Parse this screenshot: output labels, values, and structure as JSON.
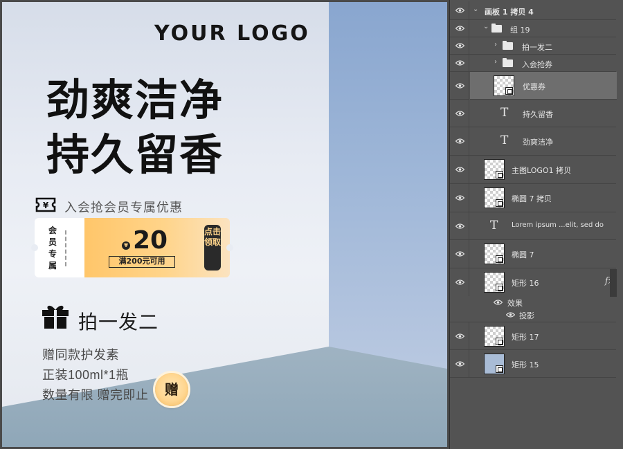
{
  "canvas": {
    "logo": "YOUR LOGO",
    "headline_line1": "劲爽洁净",
    "headline_line2": "持久留香",
    "member_text": "入会抢会员专属优惠",
    "coupon": {
      "left_label": "会员专属",
      "currency": "¥",
      "amount": "20",
      "condition": "满200元可用",
      "claim_label": "点击领取"
    },
    "gift": {
      "title": "拍一发二",
      "lines": [
        "赠同款护发素",
        "正装100ml*1瓶",
        "数量有限 赠完即止"
      ],
      "badge": "赠"
    },
    "icons": [
      "ticket-icon",
      "gift-box-icon"
    ]
  },
  "layers_panel": {
    "rows": [
      {
        "name": "画板 1 拷贝 4",
        "type": "artboard"
      },
      {
        "name": "组 19",
        "type": "group"
      },
      {
        "name": "拍一发二",
        "type": "group"
      },
      {
        "name": "入会抢券",
        "type": "group"
      },
      {
        "name": "优惠券",
        "type": "smart-object",
        "selected": true
      },
      {
        "name": "持久留香",
        "type": "text"
      },
      {
        "name": "劲爽洁净",
        "type": "text"
      },
      {
        "name": "主图LOGO1 拷贝",
        "type": "smart-object"
      },
      {
        "name": "椭圆 7 拷贝",
        "type": "shape"
      },
      {
        "name": "Lorem ipsum ...elit, sed do",
        "type": "text"
      },
      {
        "name": "椭圆 7",
        "type": "shape"
      },
      {
        "name": "矩形 16",
        "type": "shape",
        "fx": "fx"
      },
      {
        "name": "效果",
        "type": "effects"
      },
      {
        "name": "投影",
        "type": "effect"
      },
      {
        "name": "矩形 17",
        "type": "shape"
      },
      {
        "name": "矩形 15",
        "type": "shape"
      }
    ],
    "colors": {
      "panel_bg": "#535353",
      "selected_bg": "#6e6e6e",
      "text": "#e4e4e4"
    }
  }
}
